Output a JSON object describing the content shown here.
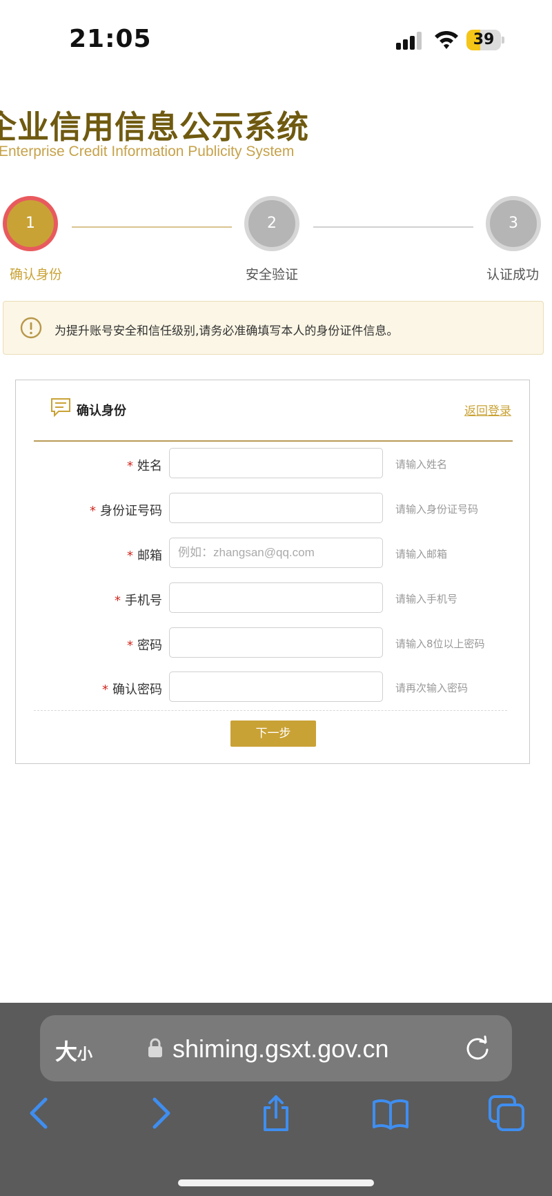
{
  "status_bar": {
    "time": "21:05",
    "battery_level": "39",
    "battery_fraction": 0.39
  },
  "header": {
    "logo_cn": "企业信用信息公示系统",
    "logo_en": "Enterprise Credit Information Publicity System"
  },
  "steps": [
    {
      "number": "1",
      "label": "确认身份",
      "state": "active"
    },
    {
      "number": "2",
      "label": "安全验证",
      "state": "inactive"
    },
    {
      "number": "3",
      "label": "认证成功",
      "state": "inactive"
    }
  ],
  "notice": {
    "text": "为提升账号安全和信任级别,请务必准确填写本人的身份证件信息。"
  },
  "form": {
    "title": "确认身份",
    "back_link": "返回登录",
    "required_mark": "*",
    "fields": [
      {
        "label": "姓名",
        "value": "",
        "placeholder": "",
        "hint": "请输入姓名"
      },
      {
        "label": "身份证号码",
        "value": "",
        "placeholder": "",
        "hint": "请输入身份证号码"
      },
      {
        "label": "邮箱",
        "value": "",
        "placeholder": "例如：zhangsan@qq.com",
        "hint": "请输入邮箱"
      },
      {
        "label": "手机号",
        "value": "",
        "placeholder": "",
        "hint": "请输入手机号"
      },
      {
        "label": "密码",
        "value": "",
        "placeholder": "",
        "hint": "请输入8位以上密码"
      },
      {
        "label": "确认密码",
        "value": "",
        "placeholder": "",
        "hint": "请再次输入密码"
      }
    ],
    "next_button": "下一步"
  },
  "browser": {
    "text_size_big": "大",
    "text_size_small": "小",
    "url": "shiming.gsxt.gov.cn"
  },
  "colors": {
    "accent_gold": "#c9a235",
    "active_ring": "#e85a5e",
    "logo_dark": "#6f5a10",
    "required_red": "#d0281f",
    "browser_chrome": "#5b5b5b",
    "nav_blue": "#3f8ef0"
  },
  "icons": {
    "notice": "exclamation-circle-icon",
    "form_title": "comment-icon",
    "lock": "lock-icon",
    "reload": "reload-icon",
    "back": "chevron-left-icon",
    "forward": "chevron-right-icon",
    "share": "share-icon",
    "bookmarks": "book-icon",
    "tabs": "tabs-icon"
  }
}
